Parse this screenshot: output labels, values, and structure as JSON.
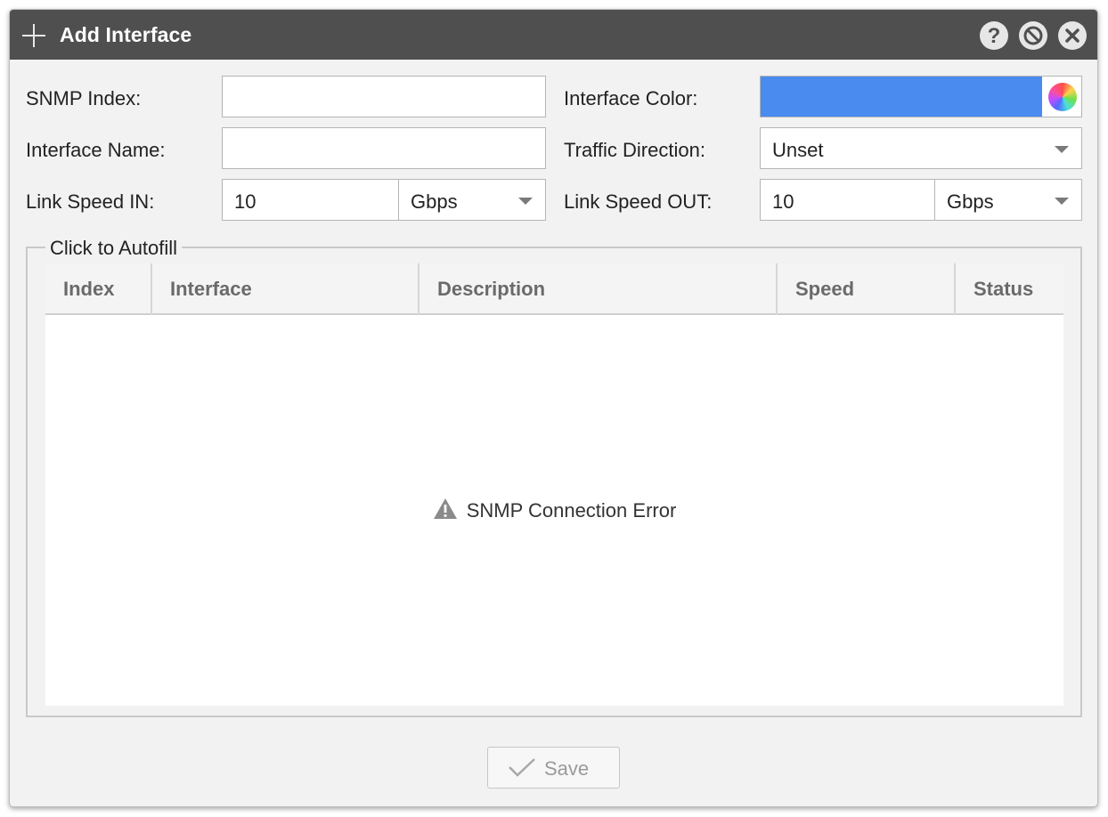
{
  "dialog": {
    "title": "Add Interface",
    "help_glyph": "?",
    "icons": {
      "add": "plus-icon",
      "help": "help-icon",
      "minimize": "minimize-icon",
      "close": "close-icon"
    }
  },
  "form": {
    "snmp_index": {
      "label": "SNMP Index:",
      "value": ""
    },
    "interface_name": {
      "label": "Interface Name:",
      "value": ""
    },
    "link_speed_in": {
      "label": "Link Speed IN:",
      "value": "10",
      "unit": "Gbps"
    },
    "interface_color": {
      "label": "Interface Color:",
      "value": "#4a8bf0",
      "picker_icon": "color-wheel-icon"
    },
    "traffic_direction": {
      "label": "Traffic Direction:",
      "value": "Unset"
    },
    "link_speed_out": {
      "label": "Link Speed OUT:",
      "value": "10",
      "unit": "Gbps"
    }
  },
  "autofill": {
    "legend": "Click to Autofill",
    "columns": [
      "Index",
      "Interface",
      "Description",
      "Speed",
      "Status"
    ],
    "empty_message": "SNMP Connection Error",
    "empty_icon": "warning-icon"
  },
  "footer": {
    "save_label": "Save",
    "save_icon": "checkmark-icon"
  }
}
